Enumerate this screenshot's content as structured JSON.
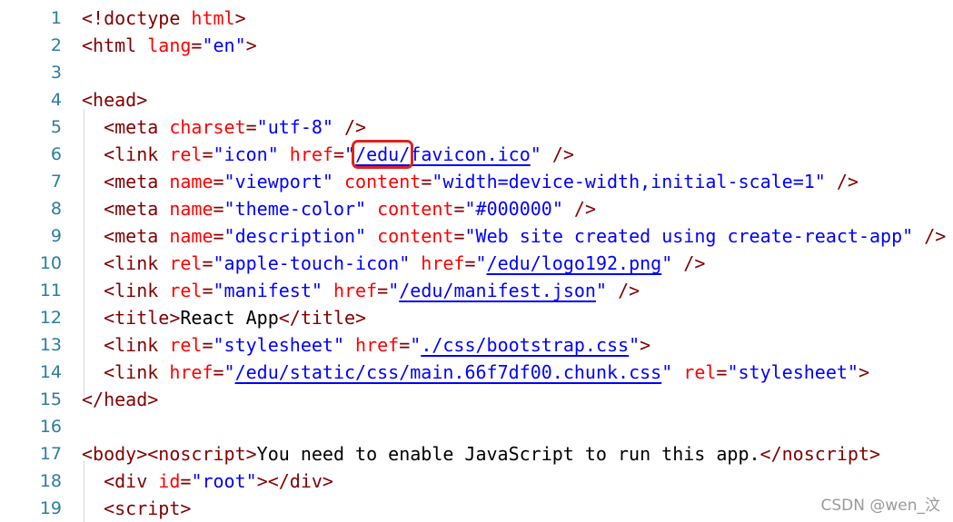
{
  "editor": {
    "line_numbers": [
      "1",
      "2",
      "3",
      "4",
      "5",
      "6",
      "7",
      "8",
      "9",
      "10",
      "11",
      "12",
      "13",
      "14",
      "15",
      "16",
      "17",
      "18",
      "19"
    ],
    "lines": [
      [
        {
          "c": "t",
          "s": "<!doctype "
        },
        {
          "c": "a",
          "s": "html"
        },
        {
          "c": "t",
          "s": ">"
        }
      ],
      [
        {
          "c": "t",
          "s": "<html "
        },
        {
          "c": "a",
          "s": "lang"
        },
        {
          "c": "t",
          "s": "="
        },
        {
          "c": "v",
          "s": "\"en\""
        },
        {
          "c": "t",
          "s": ">"
        }
      ],
      [],
      [
        {
          "c": "t",
          "s": "<head>"
        }
      ],
      [
        {
          "c": "t",
          "s": "  <meta "
        },
        {
          "c": "a",
          "s": "charset"
        },
        {
          "c": "t",
          "s": "="
        },
        {
          "c": "v",
          "s": "\"utf-8\""
        },
        {
          "c": "t",
          "s": " />"
        }
      ],
      [
        {
          "c": "t",
          "s": "  <link "
        },
        {
          "c": "a",
          "s": "rel"
        },
        {
          "c": "t",
          "s": "="
        },
        {
          "c": "v",
          "s": "\"icon\""
        },
        {
          "c": "t",
          "s": " "
        },
        {
          "c": "a",
          "s": "href"
        },
        {
          "c": "t",
          "s": "="
        },
        {
          "c": "v",
          "s": "\""
        },
        {
          "c": "lnk hl",
          "s": "/edu/"
        },
        {
          "c": "lnk",
          "s": "favicon.ico"
        },
        {
          "c": "v",
          "s": "\""
        },
        {
          "c": "t",
          "s": " />"
        }
      ],
      [
        {
          "c": "t",
          "s": "  <meta "
        },
        {
          "c": "a",
          "s": "name"
        },
        {
          "c": "t",
          "s": "="
        },
        {
          "c": "v",
          "s": "\"viewport\""
        },
        {
          "c": "t",
          "s": " "
        },
        {
          "c": "a",
          "s": "content"
        },
        {
          "c": "t",
          "s": "="
        },
        {
          "c": "v",
          "s": "\"width=device-width,initial-scale=1\""
        },
        {
          "c": "t",
          "s": " />"
        }
      ],
      [
        {
          "c": "t",
          "s": "  <meta "
        },
        {
          "c": "a",
          "s": "name"
        },
        {
          "c": "t",
          "s": "="
        },
        {
          "c": "v",
          "s": "\"theme-color\""
        },
        {
          "c": "t",
          "s": " "
        },
        {
          "c": "a",
          "s": "content"
        },
        {
          "c": "t",
          "s": "="
        },
        {
          "c": "v",
          "s": "\"#000000\""
        },
        {
          "c": "t",
          "s": " />"
        }
      ],
      [
        {
          "c": "t",
          "s": "  <meta "
        },
        {
          "c": "a",
          "s": "name"
        },
        {
          "c": "t",
          "s": "="
        },
        {
          "c": "v",
          "s": "\"description\""
        },
        {
          "c": "t",
          "s": " "
        },
        {
          "c": "a",
          "s": "content"
        },
        {
          "c": "t",
          "s": "="
        },
        {
          "c": "v",
          "s": "\"Web site created using create-react-app\""
        },
        {
          "c": "t",
          "s": " />"
        }
      ],
      [
        {
          "c": "t",
          "s": "  <link "
        },
        {
          "c": "a",
          "s": "rel"
        },
        {
          "c": "t",
          "s": "="
        },
        {
          "c": "v",
          "s": "\"apple-touch-icon\""
        },
        {
          "c": "t",
          "s": " "
        },
        {
          "c": "a",
          "s": "href"
        },
        {
          "c": "t",
          "s": "="
        },
        {
          "c": "v",
          "s": "\""
        },
        {
          "c": "lnk",
          "s": "/edu/logo192.png"
        },
        {
          "c": "v",
          "s": "\""
        },
        {
          "c": "t",
          "s": " />"
        }
      ],
      [
        {
          "c": "t",
          "s": "  <link "
        },
        {
          "c": "a",
          "s": "rel"
        },
        {
          "c": "t",
          "s": "="
        },
        {
          "c": "v",
          "s": "\"manifest\""
        },
        {
          "c": "t",
          "s": " "
        },
        {
          "c": "a",
          "s": "href"
        },
        {
          "c": "t",
          "s": "="
        },
        {
          "c": "v",
          "s": "\""
        },
        {
          "c": "lnk",
          "s": "/edu/manifest.json"
        },
        {
          "c": "v",
          "s": "\""
        },
        {
          "c": "t",
          "s": " />"
        }
      ],
      [
        {
          "c": "t",
          "s": "  <title>"
        },
        {
          "c": "",
          "s": "React App"
        },
        {
          "c": "t",
          "s": "</title>"
        }
      ],
      [
        {
          "c": "t",
          "s": "  <link "
        },
        {
          "c": "a",
          "s": "rel"
        },
        {
          "c": "t",
          "s": "="
        },
        {
          "c": "v",
          "s": "\"stylesheet\""
        },
        {
          "c": "t",
          "s": " "
        },
        {
          "c": "a",
          "s": "href"
        },
        {
          "c": "t",
          "s": "="
        },
        {
          "c": "v",
          "s": "\""
        },
        {
          "c": "lnk",
          "s": "./css/bootstrap.css"
        },
        {
          "c": "v",
          "s": "\""
        },
        {
          "c": "t",
          "s": ">"
        }
      ],
      [
        {
          "c": "t",
          "s": "  <link "
        },
        {
          "c": "a",
          "s": "href"
        },
        {
          "c": "t",
          "s": "="
        },
        {
          "c": "v",
          "s": "\""
        },
        {
          "c": "lnk",
          "s": "/edu/static/css/main.66f7df00.chunk.css"
        },
        {
          "c": "v",
          "s": "\""
        },
        {
          "c": "t",
          "s": " "
        },
        {
          "c": "a",
          "s": "rel"
        },
        {
          "c": "t",
          "s": "="
        },
        {
          "c": "v",
          "s": "\"stylesheet\""
        },
        {
          "c": "t",
          "s": ">"
        }
      ],
      [
        {
          "c": "t",
          "s": "</head>"
        }
      ],
      [],
      [
        {
          "c": "t",
          "s": "<body><noscript>"
        },
        {
          "c": "",
          "s": "You need to enable JavaScript to run this app."
        },
        {
          "c": "t",
          "s": "</noscript>"
        }
      ],
      [
        {
          "c": "t",
          "s": "  <div "
        },
        {
          "c": "a",
          "s": "id"
        },
        {
          "c": "t",
          "s": "="
        },
        {
          "c": "v",
          "s": "\"root\""
        },
        {
          "c": "t",
          "s": "></div>"
        }
      ],
      [
        {
          "c": "t",
          "s": "  <script>"
        }
      ]
    ]
  },
  "watermark": "CSDN @wen_汶",
  "colors": {
    "tag": "#800000",
    "attr": "#ff0000",
    "value": "#0000ff",
    "line_number": "#2b7da3",
    "highlight_box": "#e0231c"
  }
}
